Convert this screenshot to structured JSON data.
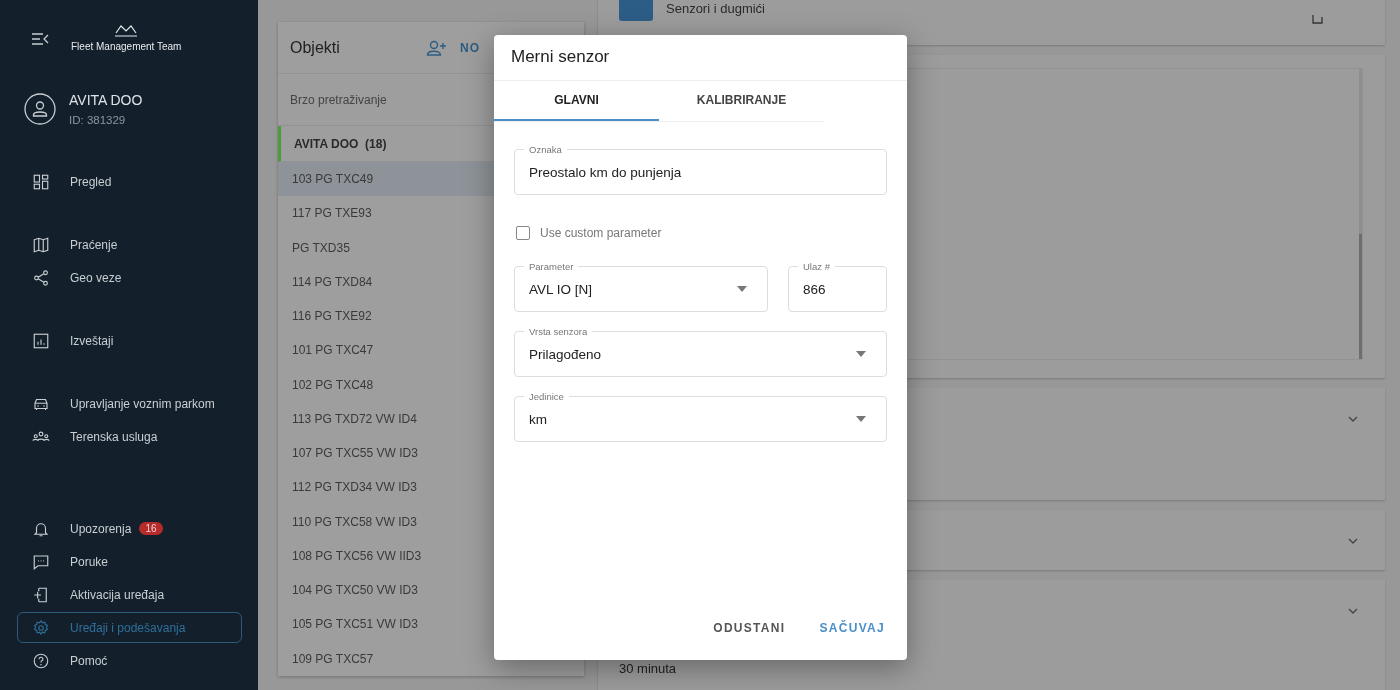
{
  "sidebar": {
    "logo_text": "Fleet Management Team",
    "account": {
      "name": "AVITA DOO",
      "id": "ID: 381329"
    },
    "groups": [
      {
        "items": [
          {
            "label": "Pregled",
            "selected": false
          }
        ]
      },
      {
        "items": [
          {
            "label": "Praćenje",
            "selected": false
          },
          {
            "label": "Geo veze",
            "selected": false
          }
        ]
      },
      {
        "items": [
          {
            "label": "Izveštaji",
            "selected": false
          }
        ]
      },
      {
        "items": [
          {
            "label": "Upravljanje voznim parkom",
            "selected": false
          },
          {
            "label": "Terenska usluga",
            "selected": false
          }
        ]
      },
      {
        "items": [
          {
            "label": "Upozorenja",
            "selected": false,
            "badge": "16"
          },
          {
            "label": "Poruke",
            "selected": false
          },
          {
            "label": "Aktivacija uređaja",
            "selected": false
          },
          {
            "label": "Uređaji i podešavanja",
            "selected": true
          },
          {
            "label": "Pomoć",
            "selected": false
          }
        ]
      }
    ]
  },
  "objects": {
    "title": "Objekti",
    "add_label": "NO",
    "search": {
      "placeholder": "Brzo pretraživanje"
    },
    "group": {
      "name": "AVITA DOO",
      "count": "(18)"
    },
    "rows": [
      {
        "name": "103 PG TXC49",
        "selected": true
      },
      {
        "name": "117 PG TXE93",
        "selected": false
      },
      {
        "name": "PG TXD35",
        "selected": false
      },
      {
        "name": "114 PG TXD84",
        "selected": false
      },
      {
        "name": "116 PG TXE92",
        "selected": false
      },
      {
        "name": "101 PG TXC47",
        "selected": false
      },
      {
        "name": "102 PG TXC48",
        "selected": false
      },
      {
        "name": "113 PG TXD72 VW ID4",
        "selected": false
      },
      {
        "name": "107 PG TXC55 VW ID3",
        "selected": false
      },
      {
        "name": "112 PG TXD34 VW ID3",
        "selected": false
      },
      {
        "name": "110 PG TXC58 VW ID3",
        "selected": false
      },
      {
        "name": "108 PG TXC56 VW IID3",
        "selected": false
      },
      {
        "name": "104 PG TXC50 VW ID3",
        "selected": false
      },
      {
        "name": "105 PG TXC51 VW ID3",
        "selected": false
      },
      {
        "name": "109 PG TXC57",
        "selected": false
      }
    ]
  },
  "details": {
    "section_title": "Senzori i dugmići",
    "interval_text": "30 minuta"
  },
  "dialog": {
    "title": "Merni senzor",
    "tabs": [
      {
        "label": "GLAVNI",
        "selected": true
      },
      {
        "label": "KALIBRIRANJE",
        "selected": false
      }
    ],
    "label_field": {
      "label": "Oznaka",
      "value": "Preostalo km do punjenja"
    },
    "custom_parameter": {
      "label": "Use custom parameter",
      "checked": false
    },
    "parameter": {
      "label": "Parameter",
      "value": "AVL IO [N]"
    },
    "input_number": {
      "label": "Ulaz #",
      "value": "866"
    },
    "sensor_type": {
      "label": "Vrsta senzora",
      "value": "Prilagođeno"
    },
    "units": {
      "label": "Jedinice",
      "value": "km"
    },
    "buttons": [
      {
        "label": "ODUSTANI",
        "kind": "secondary"
      },
      {
        "label": "SAČUVAJ",
        "kind": "primary"
      }
    ]
  }
}
